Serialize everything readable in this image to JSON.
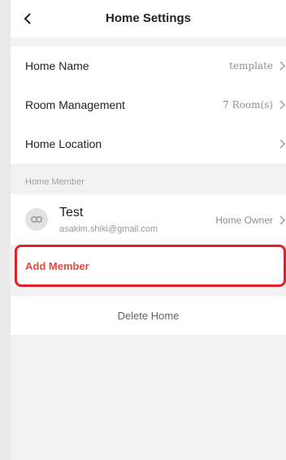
{
  "header": {
    "title": "Home Settings",
    "back_icon": "chevron-left-icon"
  },
  "settings": [
    {
      "label": "Home Name",
      "value": "template"
    },
    {
      "label": "Room Management",
      "value": "7 Room(s)"
    },
    {
      "label": "Home Location",
      "value": ""
    }
  ],
  "members_section": {
    "label": "Home Member"
  },
  "member": {
    "name": "Test",
    "email": "asakim.shiki@gmail.com",
    "role": "Home Owner",
    "avatar_icon": "avatar-icon"
  },
  "add_member": {
    "label": "Add Member"
  },
  "delete": {
    "label": "Delete Home"
  },
  "colors": {
    "accent_red": "#e8483f",
    "highlight_border": "#e0202a"
  }
}
